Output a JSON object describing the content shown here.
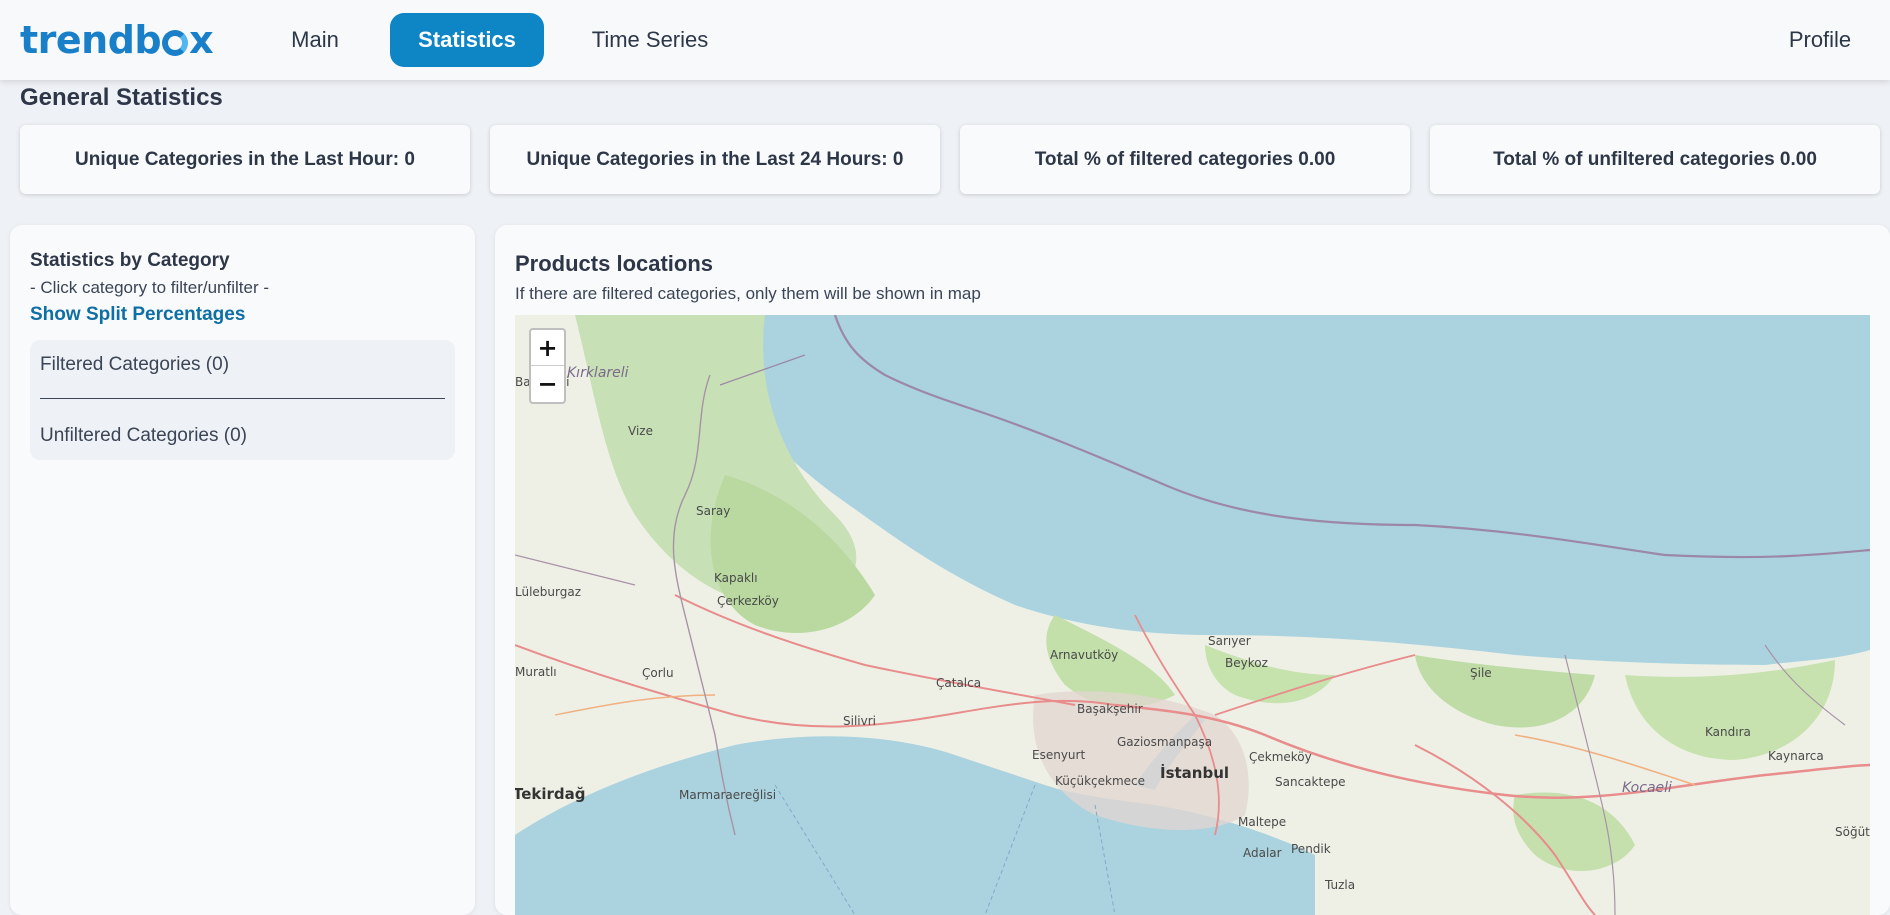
{
  "app": {
    "logo": "trendbox"
  },
  "nav": {
    "main": "Main",
    "statistics": "Statistics",
    "time_series": "Time Series",
    "profile": "Profile"
  },
  "general": {
    "title": "General Statistics",
    "cards": [
      "Unique Categories in the Last Hour: 0",
      "Unique Categories in the Last 24 Hours: 0",
      "Total % of filtered categories 0.00",
      "Total % of unfiltered categories 0.00"
    ]
  },
  "category_panel": {
    "title": "Statistics by Category",
    "hint": "- Click category to filter/unfilter -",
    "split_link": "Show Split Percentages",
    "filtered": "Filtered Categories (0)",
    "unfiltered": "Unfiltered Categories (0)"
  },
  "map_panel": {
    "title": "Products locations",
    "subtitle": "If there are filtered categories, only them will be shown in map",
    "zoom_in": "+",
    "zoom_out": "−",
    "labels": [
      "Kırklareli",
      "Vize",
      "Saray",
      "Kapaklı",
      "Çerkezköy",
      "Lüleburgaz",
      "Çorlu",
      "Çatalca",
      "Silivri",
      "Marmaraereğlisi",
      "Tekirdağ",
      "Arnavutköy",
      "Sarıyer",
      "Beykoz",
      "Başakşehir",
      "Gaziosmanpaşa",
      "Esenyurt",
      "İstanbul",
      "Küçükçekmece",
      "Çekmeköy",
      "Sancaktepe",
      "Maltepe",
      "Pendik",
      "Adalar",
      "Tuzla",
      "Şile",
      "Kandıra",
      "Kaynarca",
      "Kocaeli",
      "Söğütlü",
      "Muratlı",
      "Babaeski"
    ]
  }
}
